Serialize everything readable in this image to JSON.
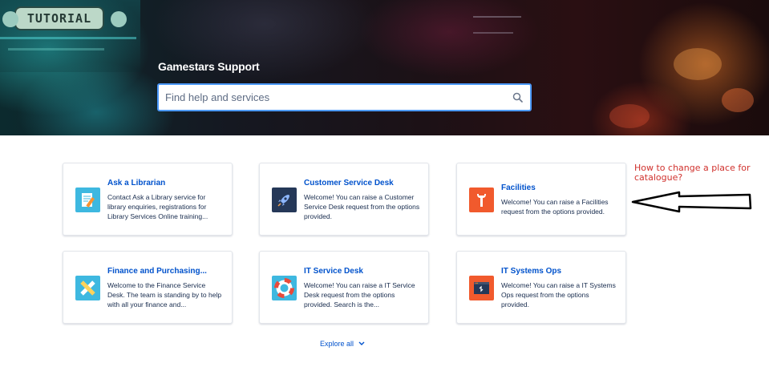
{
  "hero": {
    "sign_text": "TUTORIAL",
    "title": "Gamestars Support",
    "search_placeholder": "Find help and services"
  },
  "cards": [
    {
      "title": "Ask a Librarian",
      "description": "Contact Ask a Library service for library enquiries, registrations for Library Services Online training...",
      "icon": "notepad-pencil-icon",
      "icon_bg": "#3eb8e0"
    },
    {
      "title": "Customer Service Desk",
      "description": "Welcome! You can raise a Customer Service Desk request from the options provided.",
      "icon": "rocket-icon",
      "icon_bg": "#253858"
    },
    {
      "title": "Facilities",
      "description": "Welcome! You can raise a Facilities request from the options provided.",
      "icon": "wrench-icon",
      "icon_bg": "#f15a2d"
    },
    {
      "title": "Finance and Purchasing...",
      "description": "Welcome to the Finance Service Desk. The team is standing by to help with all your finance and...",
      "icon": "pencil-ruler-icon",
      "icon_bg": "#3eb8e0"
    },
    {
      "title": "IT Service Desk",
      "description": "Welcome! You can raise a IT Service Desk request from the options provided. Search is the...",
      "icon": "lifebuoy-icon",
      "icon_bg": "#3eb8e0"
    },
    {
      "title": "IT Systems Ops",
      "description": "Welcome! You can raise a IT Systems Ops request from the options provided.",
      "icon": "terminal-window-icon",
      "icon_bg": "#f15a2d"
    }
  ],
  "explore_all": "Explore all",
  "annotation": {
    "text": "How to change a place for catalogue?",
    "color": "#d0312d"
  },
  "colors": {
    "link": "#0052cc",
    "text": "#172b4d",
    "search_border": "#4c9aff"
  }
}
